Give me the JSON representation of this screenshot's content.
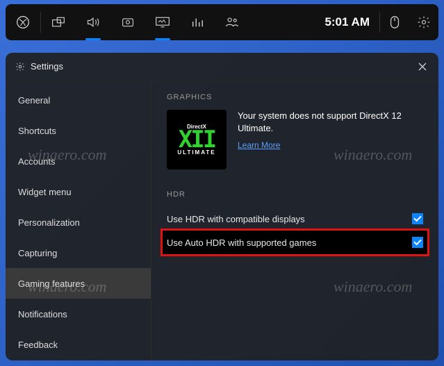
{
  "topbar": {
    "clock": "5:01 AM",
    "tabs": [
      {
        "name": "xbox",
        "active": false
      },
      {
        "name": "widgets",
        "active": false
      },
      {
        "name": "audio",
        "active": true
      },
      {
        "name": "capture",
        "active": false
      },
      {
        "name": "performance",
        "active": true
      },
      {
        "name": "resources",
        "active": false
      },
      {
        "name": "social",
        "active": false
      }
    ]
  },
  "panel": {
    "title": "Settings",
    "sidebar": [
      "General",
      "Shortcuts",
      "Accounts",
      "Widget menu",
      "Personalization",
      "Capturing",
      "Gaming features",
      "Notifications",
      "Feedback"
    ],
    "selected_index": 6,
    "graphics": {
      "section": "GRAPHICS",
      "tile_top": "DirectX",
      "tile_mid": "XII",
      "tile_bot": "ULTIMATE",
      "msg_line1": "Your system does not support DirectX 12",
      "msg_line2": "Ultimate.",
      "link": "Learn More"
    },
    "hdr": {
      "section": "HDR",
      "row1": "Use HDR with compatible displays",
      "row1_checked": true,
      "row2": "Use Auto HDR with supported games",
      "row2_checked": true
    }
  },
  "watermark": "winaero.com"
}
